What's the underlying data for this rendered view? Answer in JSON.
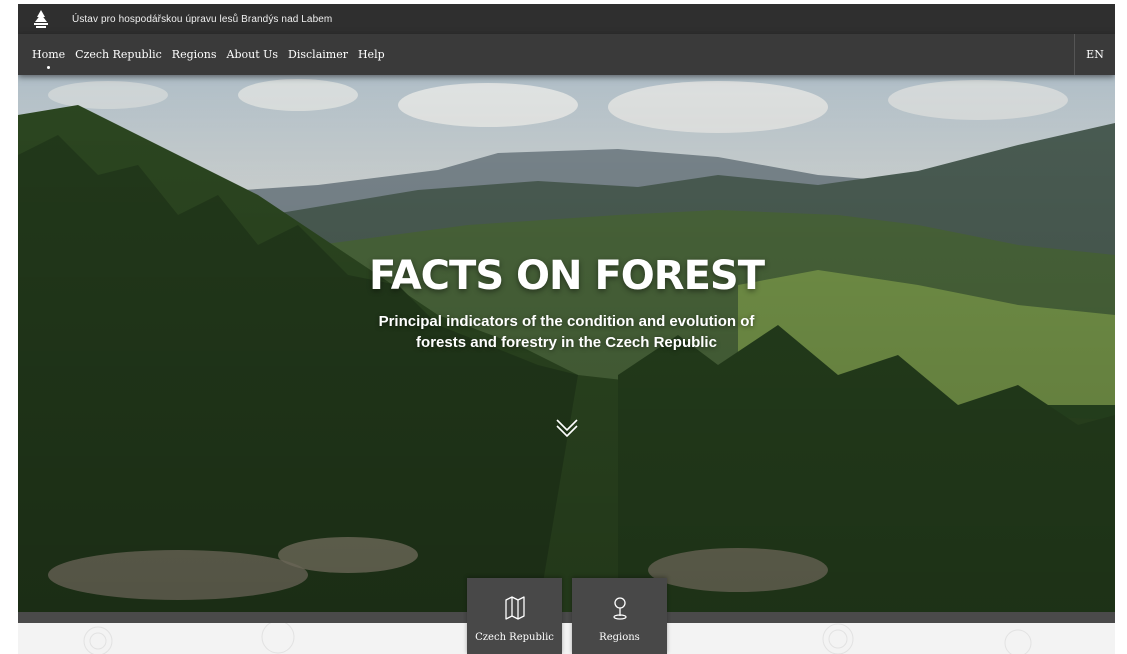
{
  "topbar": {
    "logo_icon": "institute-logo-icon",
    "org_name": "Ústav pro hospodářskou úpravu lesů Brandýs nad Labem"
  },
  "nav": {
    "items": [
      {
        "label": "Home",
        "active": true
      },
      {
        "label": "Czech Republic",
        "active": false
      },
      {
        "label": "Regions",
        "active": false
      },
      {
        "label": "About Us",
        "active": false
      },
      {
        "label": "Disclaimer",
        "active": false
      },
      {
        "label": "Help",
        "active": false
      }
    ],
    "language": "EN"
  },
  "hero": {
    "title": "FACTS ON FOREST",
    "subtitle": "Principal indicators of the condition and evolution of forests and forestry in the Czech Republic",
    "scroll_icon": "double-chevron-down-icon"
  },
  "tiles": [
    {
      "label": "Czech Republic",
      "icon": "map-icon"
    },
    {
      "label": "Regions",
      "icon": "location-pin-icon"
    }
  ],
  "colors": {
    "topbar": "#2f2f2f",
    "navbar": "#3a3a3a",
    "tile": "#484848",
    "text": "#ffffff"
  }
}
